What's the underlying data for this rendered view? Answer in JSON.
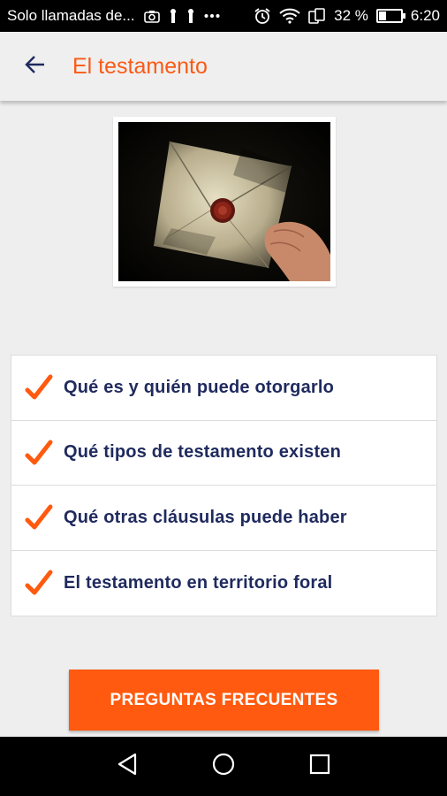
{
  "status_bar": {
    "carrier_text": "Solo llamadas de...",
    "battery_text": "32 %",
    "battery_level": 0.32,
    "time": "6:20",
    "icons": [
      "camera-icon",
      "usb-icon",
      "usb-icon",
      "more-icon",
      "alarm-icon",
      "wifi-icon",
      "sim-icon",
      "battery-icon"
    ]
  },
  "app_bar": {
    "title": "El testamento",
    "back_icon": "arrow-back-icon"
  },
  "image": {
    "subject": "sealed-envelope-photo"
  },
  "topics": [
    {
      "label": "Qué es y quién puede otorgarlo",
      "icon": "check-icon"
    },
    {
      "label": "Qué tipos de testamento existen",
      "icon": "check-icon"
    },
    {
      "label": "Qué otras cláusulas puede haber",
      "icon": "check-icon"
    },
    {
      "label": "El testamento en territorio foral",
      "icon": "check-icon"
    }
  ],
  "faq_button": {
    "label": "PREGUNTAS FRECUENTES"
  },
  "nav_bar": {
    "icons": [
      "nav-back-icon",
      "nav-home-icon",
      "nav-recents-icon"
    ]
  },
  "colors": {
    "accent": "#fa5a16",
    "button": "#ff5a0f",
    "topic_text": "#1f2a5e",
    "background": "#eeeeee"
  }
}
